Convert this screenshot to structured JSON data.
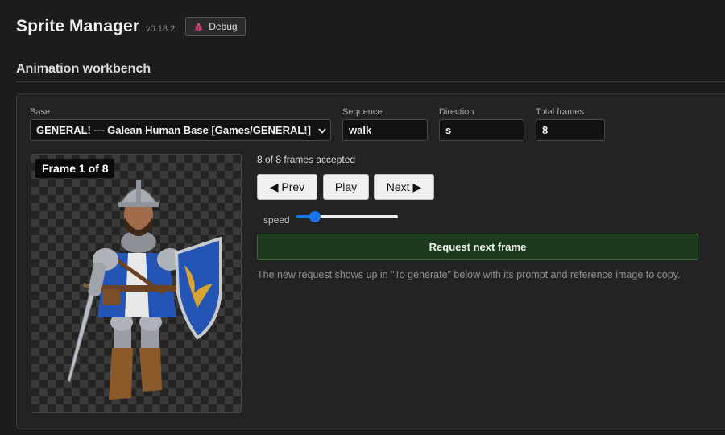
{
  "app": {
    "title": "Sprite Manager",
    "version": "v0.18.2",
    "debug_label": "Debug"
  },
  "section": {
    "title": "Animation workbench"
  },
  "fields": {
    "base": {
      "label": "Base",
      "value": "GENERAL! — Galean Human Base [Games/GENERAL!]"
    },
    "sequence": {
      "label": "Sequence",
      "value": "walk"
    },
    "direction": {
      "label": "Direction",
      "value": "s"
    },
    "total_frames": {
      "label": "Total frames",
      "value": "8"
    }
  },
  "preview": {
    "frame_badge": "Frame 1 of 8"
  },
  "status": {
    "accepted": "8 of 8 frames accepted"
  },
  "controls": {
    "prev_label": "◀ Prev",
    "play_label": "Play",
    "next_label": "Next ▶"
  },
  "speed": {
    "label": "speed",
    "level": 0.18
  },
  "request": {
    "button_label": "Request next frame"
  },
  "help": {
    "text": "The new request shows up in \"To generate\" below with its prompt and reference image to copy."
  },
  "colors": {
    "accent": "#1a73e8",
    "request_bg": "#1d3a1e",
    "background": "#1c1c1c"
  },
  "icons": {
    "debug": "bug-icon",
    "dropdown": "chevron-down-icon"
  }
}
